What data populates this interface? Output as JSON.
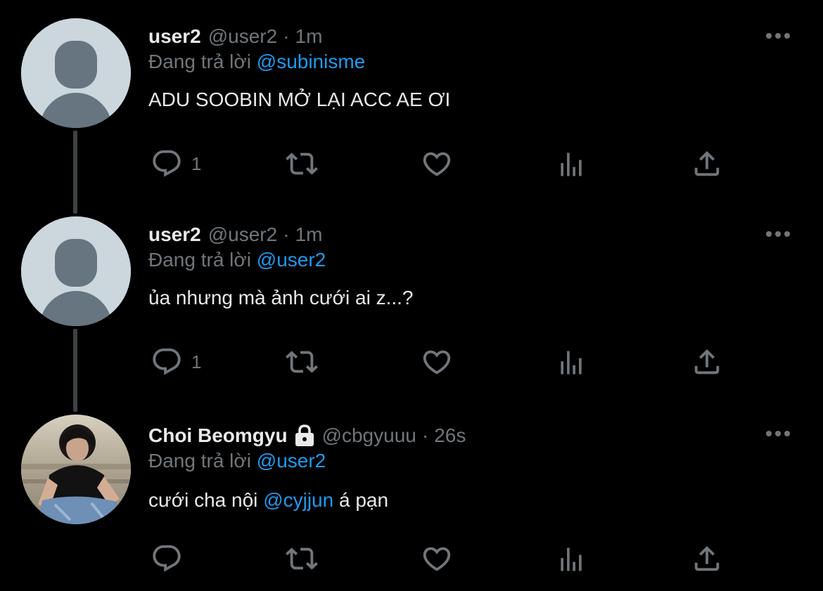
{
  "tweets": [
    {
      "name": "user2",
      "handle": "@user2",
      "separator": "·",
      "time": "1m",
      "reply_prefix": "Đang trả lời",
      "reply_to": "@subinisme",
      "text": "ADU SOOBIN MỞ LẠI ACC AE ƠI",
      "reply_count": "1",
      "avatar": "default-avatar"
    },
    {
      "name": "user2",
      "handle": "@user2",
      "separator": "·",
      "time": "1m",
      "reply_prefix": "Đang trả lời",
      "reply_to": "@user2",
      "text": "ủa nhưng mà ảnh cưới ai z...?",
      "reply_count": "1",
      "avatar": "default-avatar"
    },
    {
      "name": "Choi Beomgyu",
      "protected": true,
      "handle": "@cbgyuuu",
      "separator": "·",
      "time": "26s",
      "reply_prefix": "Đang trả lời",
      "reply_to": "@user2",
      "text_before": "cưới cha nội ",
      "text_mention": "@cyjjun",
      "text_after": " á pạn",
      "reply_count": "",
      "avatar": "photo-avatar"
    }
  ],
  "icons": {
    "reply": "reply-icon",
    "retweet": "retweet-icon",
    "like": "heart-icon",
    "views": "analytics-icon",
    "share": "share-icon",
    "more": "more-icon",
    "lock": "lock-icon"
  },
  "colors": {
    "background": "#000000",
    "primary_text": "#e7e9ea",
    "secondary_text": "#71767b",
    "accent": "#1d9bf0",
    "thread_line": "#3e4144"
  }
}
